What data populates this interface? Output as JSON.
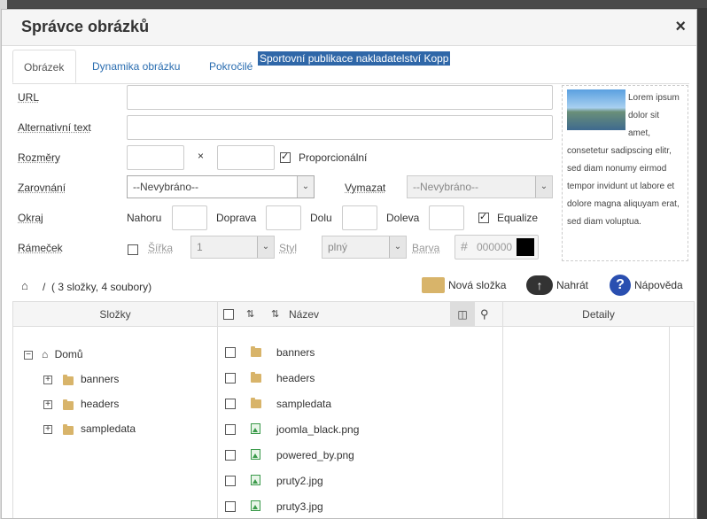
{
  "dialog": {
    "title": "Správce obrázků",
    "close_icon": "×"
  },
  "tabs": [
    {
      "label": "Obrázek",
      "active": true
    },
    {
      "label": "Dynamika obrázku",
      "active": false
    },
    {
      "label": "Pokročilé",
      "active": false
    }
  ],
  "highlight_text": "Sportovní publikace nakladatelství Kopp",
  "form": {
    "url_label": "URL",
    "alt_label": "Alternativní text",
    "size_label": "Rozměry",
    "size_sep": "×",
    "proportional_label": "Proporcionální",
    "proportional_checked": true,
    "align_label": "Zarovnání",
    "align_value": "--Nevybráno--",
    "clear_label": "Vymazat",
    "clear_value": "--Nevybráno--",
    "margin_label": "Okraj",
    "margin_top_label": "Nahoru",
    "margin_right_label": "Doprava",
    "margin_bottom_label": "Dolu",
    "margin_left_label": "Doleva",
    "equalize_label": "Equalize",
    "equalize_checked": true,
    "border_label": "Rámeček",
    "border_width_label": "Šířka",
    "border_width_value": "1",
    "border_style_label": "Styl",
    "border_style_value": "plný",
    "border_color_label": "Barva",
    "border_color_hash": "#",
    "border_color_value": "000000",
    "border_color_swatch": "#000000"
  },
  "preview": {
    "text": "Lorem ipsum dolor sit amet, consetetur sadipscing elitr, sed diam nonumy eirmod tempor invidunt ut labore et dolore magna aliquyam erat, sed diam voluptua."
  },
  "toolbar": {
    "breadcrumb_sep": "/",
    "breadcrumb_info": "( 3 složky, 4 soubory)",
    "new_folder": "Nová složka",
    "upload": "Nahrát",
    "help": "Nápověda"
  },
  "columns": {
    "folders": "Složky",
    "name": "Název",
    "details": "Detaily"
  },
  "tree": {
    "root": "Domů",
    "children": [
      "banners",
      "headers",
      "sampledata"
    ]
  },
  "files": [
    {
      "name": "banners",
      "type": "folder"
    },
    {
      "name": "headers",
      "type": "folder"
    },
    {
      "name": "sampledata",
      "type": "folder"
    },
    {
      "name": "joomla_black.png",
      "type": "image"
    },
    {
      "name": "powered_by.png",
      "type": "image"
    },
    {
      "name": "pruty2.jpg",
      "type": "image"
    },
    {
      "name": "pruty3.jpg",
      "type": "image"
    }
  ]
}
